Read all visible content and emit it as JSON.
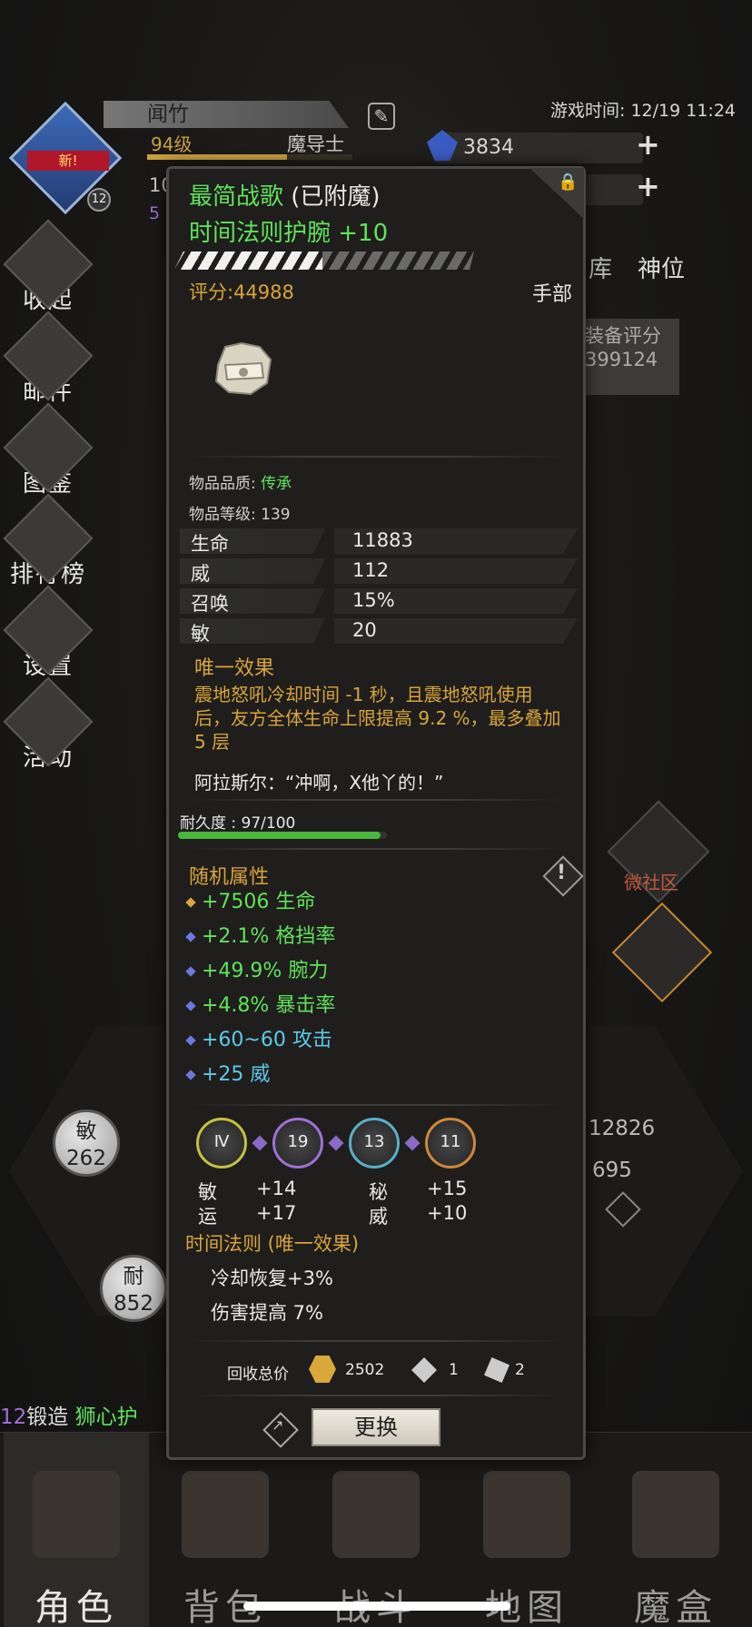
{
  "status": {
    "game_time": "游戏时间: 12/19 11:24"
  },
  "player": {
    "name": "闻竹",
    "level": "94级",
    "class": "魔导士",
    "avatar_badge": "新!",
    "avatar_level": "12",
    "xp_progress": 0.68,
    "currency": "3834",
    "partial_left": "10",
    "partial_left2": "5"
  },
  "side_menu": [
    {
      "label": "收起",
      "icon": "collapse-icon"
    },
    {
      "label": "邮件",
      "icon": "mail-icon"
    },
    {
      "label": "图鉴",
      "icon": "book-icon"
    },
    {
      "label": "排行榜",
      "icon": "ranking-icon"
    },
    {
      "label": "设置",
      "icon": "gear-icon"
    },
    {
      "label": "活动",
      "icon": "activity-icon"
    }
  ],
  "tabs_hint": {
    "storage": "库",
    "divine": "神位"
  },
  "equip_score": {
    "label": "装备评分",
    "value": "399124"
  },
  "background_stats": {
    "agi_label": "敏",
    "agi_value": "262",
    "end_label": "耐",
    "end_value": "852",
    "right_1": "12826",
    "right_2": "695"
  },
  "community": {
    "label": "微社区"
  },
  "forge_line": {
    "num": "12",
    "text": "锻造",
    "item": "狮心护"
  },
  "item": {
    "enchant_name": "最简战歌",
    "enchant_tag": "(已附魔)",
    "name": "时间法则护腕 +10",
    "score": "评分:44988",
    "slot": "手部",
    "quality_label": "物品品质:",
    "quality_value": "传承",
    "level_line": "物品等级: 139",
    "base_stats": [
      {
        "label": "生命",
        "value": "11883"
      },
      {
        "label": "威",
        "value": "112"
      },
      {
        "label": "召唤",
        "value": "15%"
      },
      {
        "label": "敏",
        "value": "20"
      }
    ],
    "unique_title": "唯一效果",
    "unique_desc": "震地怒吼冷却时间 -1 秒，且震地怒吼使用后，友方全体生命上限提高 9.2 %，最多叠加 5 层",
    "quote": "阿拉斯尔：“冲啊，X他丫的！”",
    "durability_label": "耐久度 : 97/100",
    "durability": 0.97,
    "random_title": "随机属性",
    "random_attrs": [
      {
        "text": "+7506 生命",
        "color": "#5fe25a",
        "dot": "#d9a43a"
      },
      {
        "text": "+2.1% 格挡率",
        "color": "#5fe25a",
        "dot": "#6a78e0"
      },
      {
        "text": "+49.9% 腕力",
        "color": "#5fe25a",
        "dot": "#6a78e0"
      },
      {
        "text": "+4.8% 暴击率",
        "color": "#5fe25a",
        "dot": "#6a78e0"
      },
      {
        "text": "+60~60 攻击",
        "color": "#5ec8e8",
        "dot": "#6a78e0"
      },
      {
        "text": "+25 威",
        "color": "#5ec8e8",
        "dot": "#6a78e0"
      }
    ],
    "gems": [
      {
        "glyph": "Ⅳ",
        "ring": "#c6c040"
      },
      {
        "glyph": "19",
        "ring": "#a070d8"
      },
      {
        "glyph": "13",
        "ring": "#58b0c8"
      },
      {
        "glyph": "11",
        "ring": "#d08838"
      }
    ],
    "gem_stats": [
      {
        "label": "敏",
        "value": "+14"
      },
      {
        "label": "秘",
        "value": "+15"
      },
      {
        "label": "运",
        "value": "+17"
      },
      {
        "label": "威",
        "value": "+10"
      }
    ],
    "set_title": "时间法则 (唯一效果)",
    "set_lines": [
      "冷却恢复+3%",
      "伤害提高 7%"
    ],
    "recycle_label": "回收总价",
    "recycle_gold": "2502",
    "recycle_stone": "1",
    "recycle_shard": "2",
    "replace_button": "更换"
  },
  "bottom_nav": [
    {
      "label": "角色",
      "icon": "helmet-icon",
      "active": true
    },
    {
      "label": "背包",
      "icon": "backpack-icon",
      "active": false
    },
    {
      "label": "战斗",
      "icon": "sword-shield-icon",
      "active": false
    },
    {
      "label": "地图",
      "icon": "map-scroll-icon",
      "active": false
    },
    {
      "label": "魔盒",
      "icon": "magic-box-icon",
      "active": false
    }
  ],
  "colors": {
    "legendary_green": "#5fe25a",
    "gold": "#d9a43a",
    "panel_bg": "#1f1e1c"
  }
}
